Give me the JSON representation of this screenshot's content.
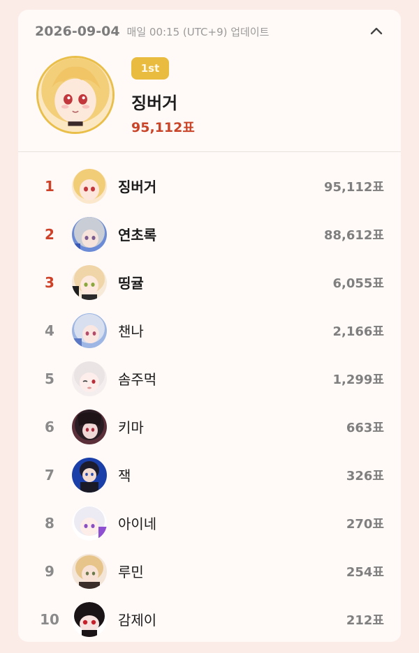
{
  "header": {
    "date": "2026-09-04",
    "update_note": "매일 00:15 (UTC+9) 업데이트",
    "collapse_icon": "chevron-up-icon"
  },
  "top_entry": {
    "badge": "1st",
    "name": "징버거",
    "votes": "95,112표",
    "frame_color": "#e9bf4a"
  },
  "colors": {
    "background": "#fcece7",
    "card": "#fffaf7",
    "accent_red": "#cd4128",
    "badge_gold": "#e9bb3f",
    "muted_text": "#7f7f7f"
  },
  "rankings": [
    {
      "rank": "1",
      "name": "징버거",
      "votes": "95,112표"
    },
    {
      "rank": "2",
      "name": "연초록",
      "votes": "88,612표"
    },
    {
      "rank": "3",
      "name": "띵귤",
      "votes": "6,055표"
    },
    {
      "rank": "4",
      "name": "챈나",
      "votes": "2,166표"
    },
    {
      "rank": "5",
      "name": "솜주먹",
      "votes": "1,299표"
    },
    {
      "rank": "6",
      "name": "키마",
      "votes": "663표"
    },
    {
      "rank": "7",
      "name": "잭",
      "votes": "326표"
    },
    {
      "rank": "8",
      "name": "아이네",
      "votes": "270표"
    },
    {
      "rank": "9",
      "name": "루민",
      "votes": "254표"
    },
    {
      "rank": "10",
      "name": "감제이",
      "votes": "212표"
    }
  ]
}
